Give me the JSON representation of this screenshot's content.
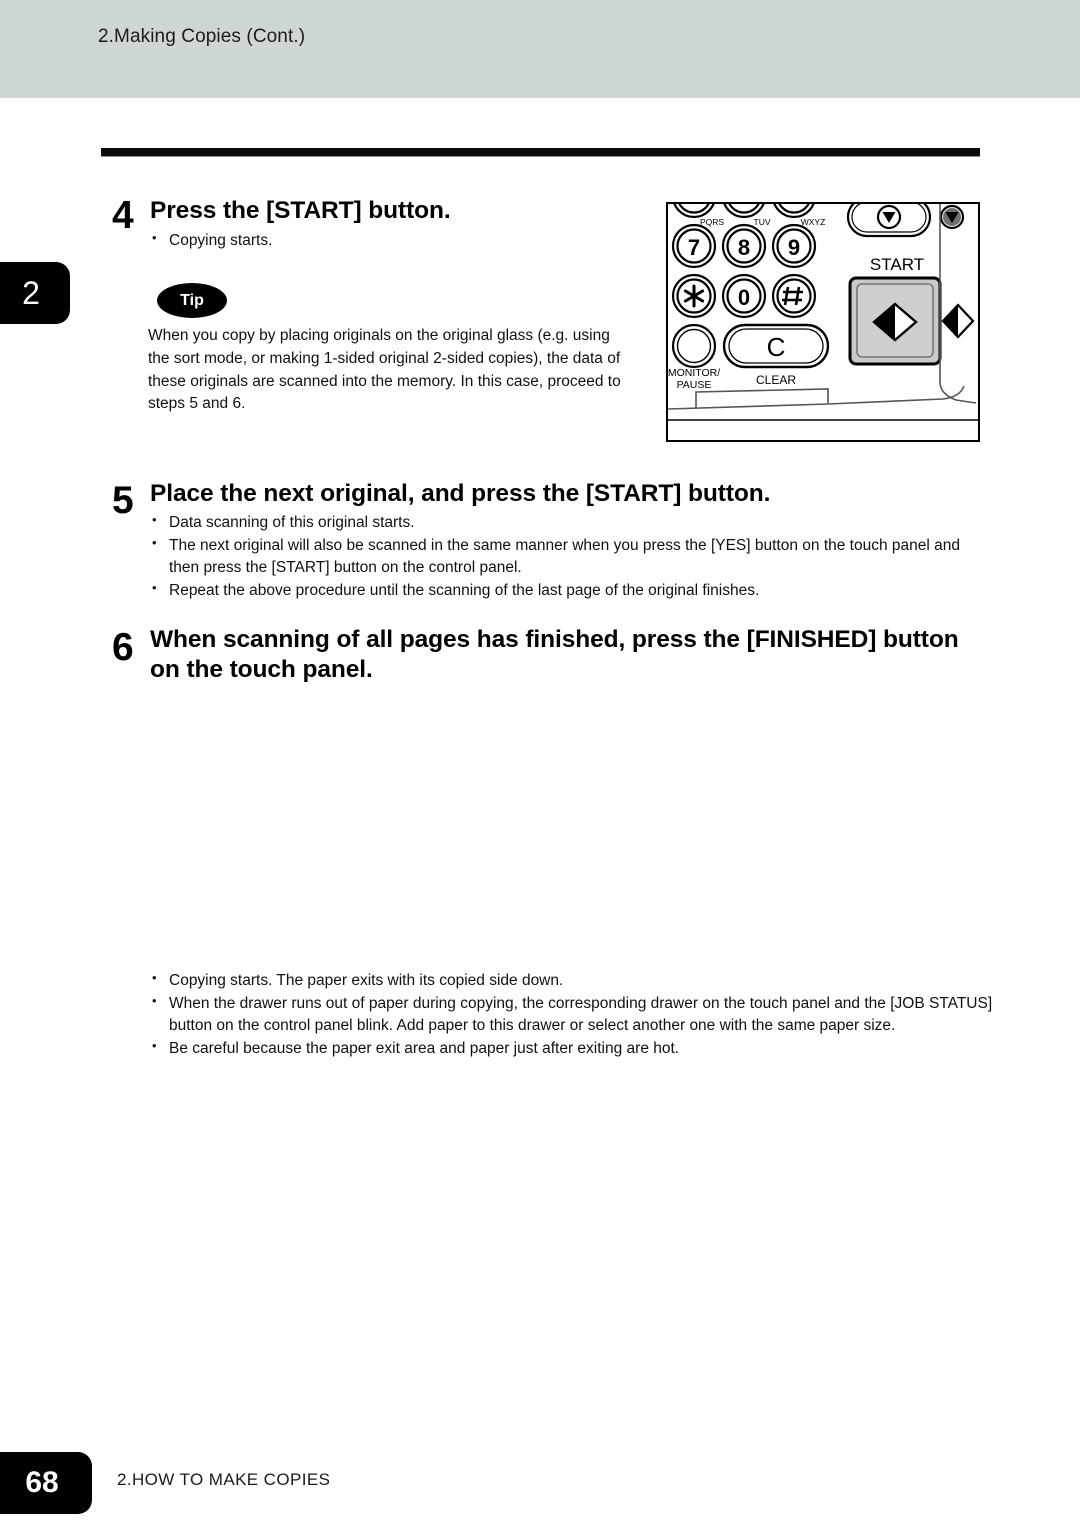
{
  "header": {
    "running_title": "2.Making Copies (Cont.)",
    "band_color": "#ced6d6"
  },
  "chapter_tab": {
    "number": "2"
  },
  "steps": [
    {
      "number": "4",
      "heading": "Press the [START] button.",
      "bullets": [
        "Copying starts."
      ]
    },
    {
      "number": "5",
      "heading": "Place the next original, and press the [START] button.",
      "bullets": [
        "Data scanning of this original starts.",
        "The next original will also be scanned in the same manner when you press the [YES] button on the touch panel and then press the [START] button on the control panel.",
        "Repeat the above procedure until the scanning of the last page of the original finishes."
      ]
    },
    {
      "number": "6",
      "heading": "When scanning of all pages has finished, press the [FINISHED] button on the touch panel.",
      "bullets": [
        "Copying starts. The paper exits with its copied side down.",
        "When the drawer runs out of paper during copying, the corresponding drawer on the touch panel and the [JOB STATUS] button on the control panel blink. Add paper to this drawer or select another one with the same paper size.",
        "Be careful because the paper exit area and paper just after exiting are hot."
      ]
    }
  ],
  "tip": {
    "badge_label": "Tip",
    "text": "When you copy by placing originals on the original glass (e.g. using the sort mode, or making 1-sided original 2-sided copies), the data of these originals are scanned into the memory. In this case, proceed to steps 5 and 6."
  },
  "control_panel": {
    "keys": [
      {
        "digit": "7",
        "letters": "PQRS"
      },
      {
        "digit": "8",
        "letters": "TUV"
      },
      {
        "digit": "9",
        "letters": "WXYZ"
      },
      {
        "digit": "✳",
        "letters": ""
      },
      {
        "digit": "0",
        "letters": ""
      },
      {
        "digit": "#",
        "letters": ""
      }
    ],
    "clear_label": "CLEAR",
    "clear_glyph": "C",
    "monitor_label_line1": "MONITOR/",
    "monitor_label_line2": "PAUSE",
    "start_label": "START",
    "start_button_color": "#c9c9c9"
  },
  "footer": {
    "page_number": "68",
    "section_title": "2.HOW TO MAKE COPIES"
  }
}
